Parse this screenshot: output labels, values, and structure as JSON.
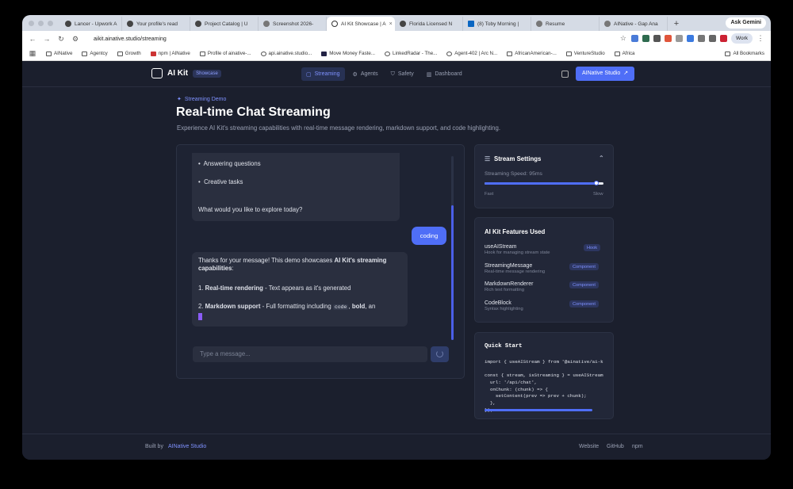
{
  "browser": {
    "tabs": [
      {
        "label": "Lancer - Upwork A"
      },
      {
        "label": "Your profile's read"
      },
      {
        "label": "Project Catalog | U"
      },
      {
        "label": "Screenshot 2026-"
      },
      {
        "label": "AI Kit Showcase | A"
      },
      {
        "label": "Florida Licensed N"
      },
      {
        "label": "(8) Toby Morning |"
      },
      {
        "label": "Resume"
      },
      {
        "label": "AINative - Gap Ana"
      }
    ],
    "new_tab": "+",
    "ask_gemini": "Ask Gemini",
    "url": "aikit.ainative.studio/streaming",
    "profile": "Work",
    "bookmarks": [
      "AINative",
      "Agentcy",
      "Growth",
      "npm | AINative",
      "Profile of ainative-...",
      "api.ainative.studio...",
      "Move Money Faste...",
      "LinkedRadar - The...",
      "Agent-402 | Arc N...",
      "AfricanAmerican-...",
      "VentureStudio",
      "Africa"
    ],
    "all_bookmarks": "All Bookmarks"
  },
  "nav": {
    "brand": "AI Kit",
    "badge": "Showcase",
    "links": [
      "Streaming",
      "Agents",
      "Safety",
      "Dashboard"
    ],
    "cta": "AINative Studio"
  },
  "hero": {
    "tag": "Streaming Demo",
    "title": "Real-time Chat Streaming",
    "subtitle": "Experience AI Kit's streaming capabilities with real-time message rendering, markdown support, and code highlighting."
  },
  "chat": {
    "assistant1": {
      "bullets": [
        "Answering questions",
        "Creative tasks"
      ],
      "closing": "What would you like to explore today?"
    },
    "user": "coding",
    "assistant2": {
      "intro": "Thanks for your message! This demo showcases ",
      "intro_bold": "AI Kit's streaming capabilities",
      "intro_end": ":",
      "item1_num": "1. ",
      "item1_bold": "Real-time rendering",
      "item1_text": " - Text appears as it's generated",
      "item2_num": "2. ",
      "item2_bold": "Markdown support",
      "item2_text": " - Full formatting including ",
      "item2_code": "code",
      "item2_sep": ", ",
      "item2_bold2": "bold",
      "item2_end": ", an"
    },
    "input_placeholder": "Type a message..."
  },
  "stream_settings": {
    "title": "Stream Settings",
    "speed_label": "Streaming Speed: 95ms",
    "min_label": "Fast",
    "max_label": "Slow",
    "slider_fraction": 0.94
  },
  "features": {
    "title": "AI Kit Features Used",
    "items": [
      {
        "name": "useAIStream",
        "desc": "Hook for managing stream state",
        "tag": "Hook"
      },
      {
        "name": "StreamingMessage",
        "desc": "Real-time message rendering",
        "tag": "Component"
      },
      {
        "name": "MarkdownRenderer",
        "desc": "Rich text formatting",
        "tag": "Component"
      },
      {
        "name": "CodeBlock",
        "desc": "Syntax highlighting",
        "tag": "Component"
      }
    ]
  },
  "quick_start": {
    "title": "Quick Start",
    "code": "import { useAIStream } from '@ainative/ai-k\n\nconst { stream, isStreaming } = useAIStream\n  url: '/api/chat',\n  onChunk: (chunk) => {\n    setContent(prev => prev + chunk);\n  },\n});"
  },
  "footer": {
    "built_by": "Built by",
    "built_by_link": "AINative Studio",
    "links": [
      "Website",
      "GitHub",
      "npm"
    ]
  },
  "colors": {
    "accent": "#4f6ef7",
    "background": "#1b1f2d",
    "panel": "#222738"
  }
}
